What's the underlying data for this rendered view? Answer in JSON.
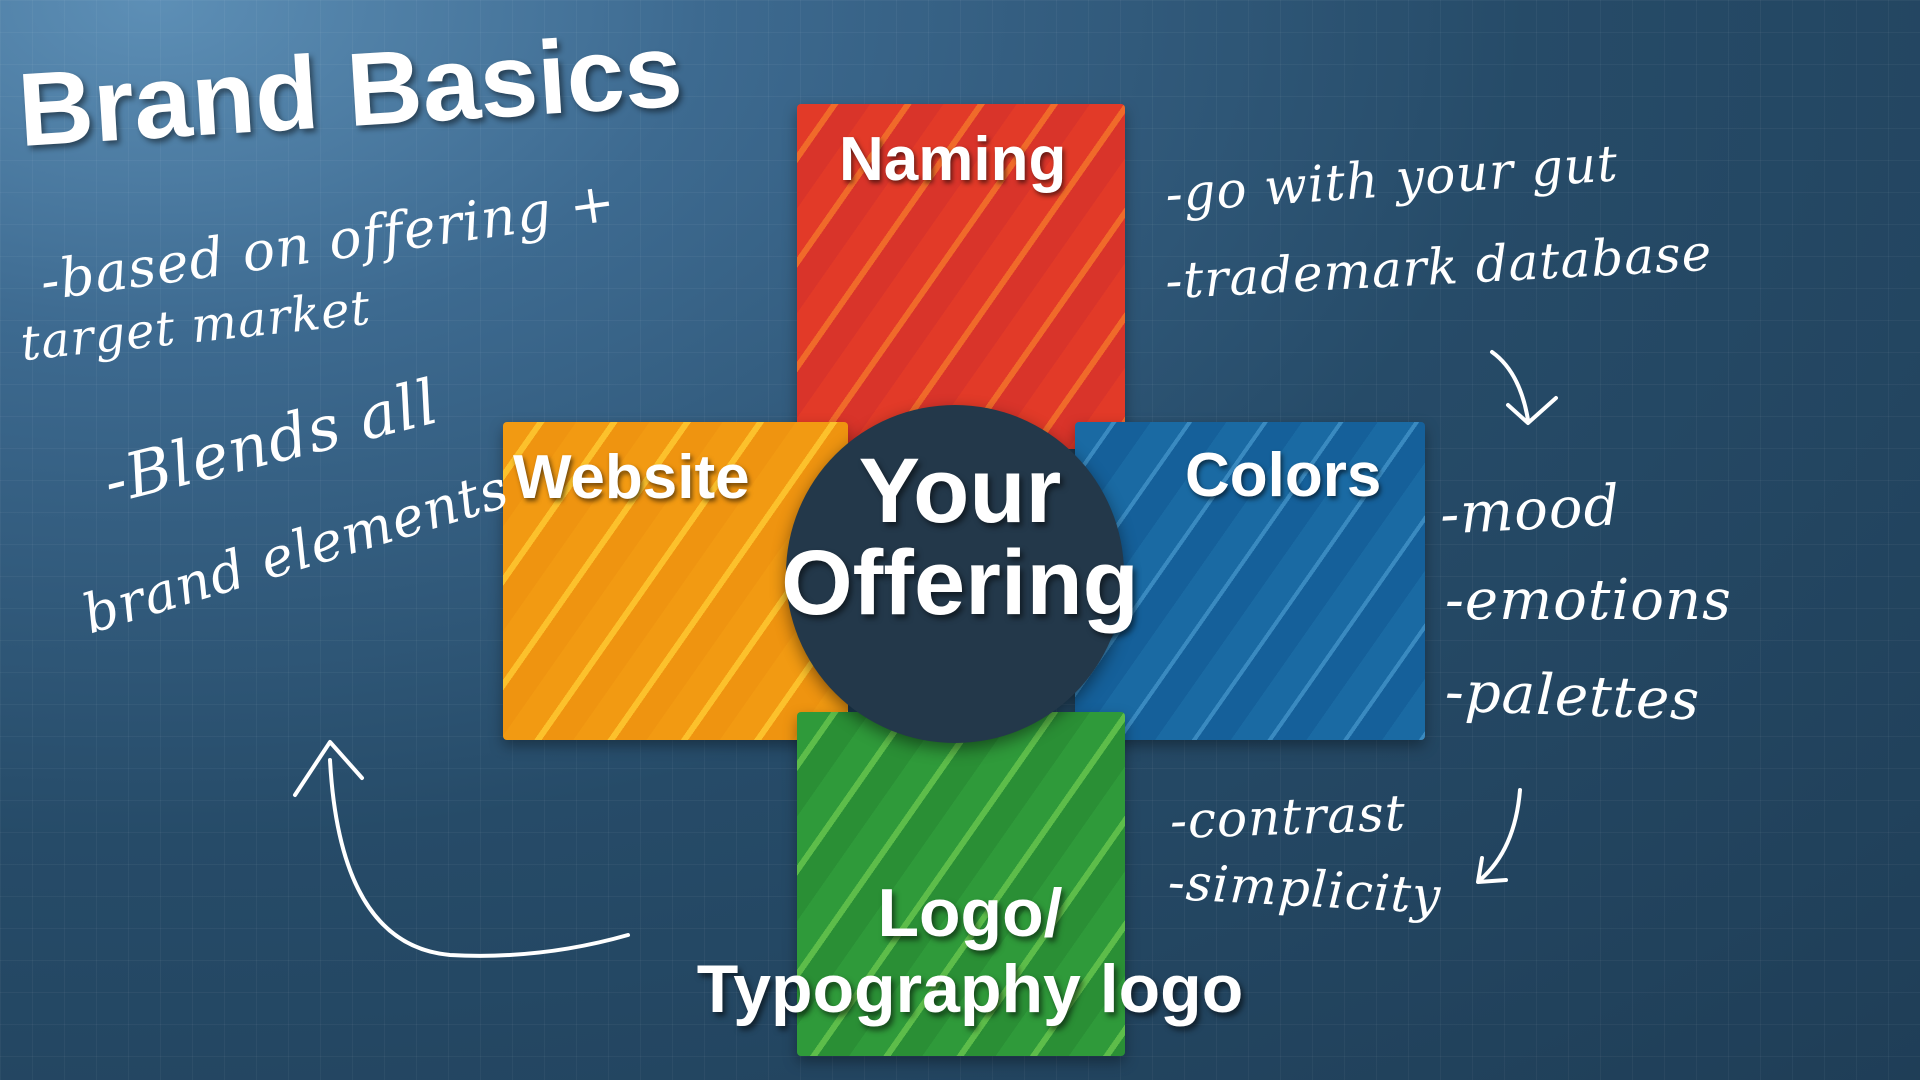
{
  "title": "Brand Basics",
  "center": {
    "line1": "Your",
    "line2": "Offering"
  },
  "boxes": {
    "naming": "Naming",
    "website": "Website",
    "colors": "Colors",
    "logo_line1": "Logo/",
    "logo_line2": "Typography logo"
  },
  "notes": {
    "left_top_1": "-based on offering +",
    "left_top_2": "target market",
    "left_mid_1": "-Blends all",
    "left_mid_2": "brand elements",
    "right_top_1": "-go with your gut",
    "right_top_2": "-trademark database",
    "right_mid_1": "-mood",
    "right_mid_2": "-emotions",
    "right_mid_3": "-palettes",
    "right_bot_1": "-contrast",
    "right_bot_2": "-simplicity"
  },
  "colors": {
    "naming": "#e23a28",
    "website": "#f29a12",
    "colors": "#1a6aa3",
    "logo": "#2f9a3a",
    "center": "#23384a"
  }
}
